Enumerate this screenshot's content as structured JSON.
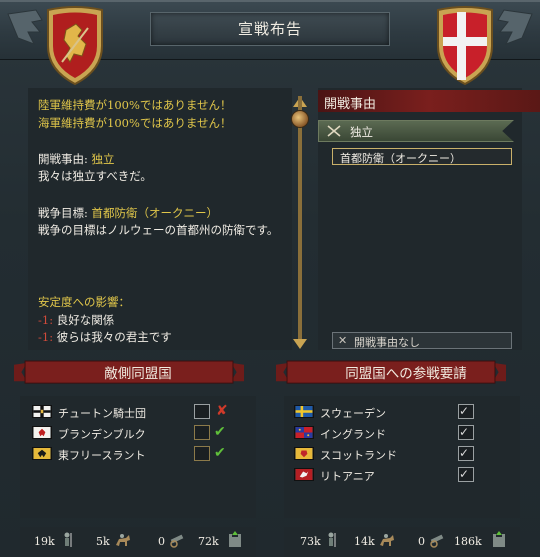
{
  "window": {
    "title": "宣戦布告"
  },
  "warnings": {
    "army": "陸軍維持費が100%ではありません！",
    "navy": "海軍維持費が100%ではありません！"
  },
  "casus_belli": {
    "label": "開戦事由: ",
    "value": "独立",
    "description": "我々は独立すべきだ。"
  },
  "war_goal": {
    "label": "戦争目標: ",
    "value": "首都防衛（オークニー）",
    "description": "戦争の目標はノルウェーの首都州の防衛です。"
  },
  "stability": {
    "title": "安定度への影響：",
    "items": [
      {
        "value": "-1",
        "text": "良好な関係"
      },
      {
        "value": "-1",
        "text": "彼らは我々の君主です"
      }
    ]
  },
  "right_panel": {
    "header": "開戦事由",
    "selected_cb": "独立",
    "selected_goal": "首都防衛（オークニー）",
    "no_cb": "開戦事由なし"
  },
  "enemy_allies": {
    "header": "敵側同盟国",
    "rows": [
      {
        "name": "チュートン騎士団",
        "flag": "teutonic-flag",
        "status": "declined"
      },
      {
        "name": "ブランデンブルク",
        "flag": "brandenburg-flag",
        "status": "accepted"
      },
      {
        "name": "東フリースラント",
        "flag": "east-frisia-flag",
        "status": "accepted"
      }
    ],
    "stats": {
      "infantry": "19k",
      "cavalry": "5k",
      "artillery": "0",
      "total": "72k"
    }
  },
  "call_allies": {
    "header": "同盟国への参戦要請",
    "rows": [
      {
        "name": "スウェーデン",
        "flag": "sweden-flag",
        "checked": true
      },
      {
        "name": "イングランド",
        "flag": "england-flag",
        "checked": true
      },
      {
        "name": "スコットランド",
        "flag": "scotland-flag",
        "checked": true
      },
      {
        "name": "リトアニア",
        "flag": "lithuania-flag",
        "checked": true
      }
    ],
    "stats": {
      "infantry": "73k",
      "cavalry": "14k",
      "artillery": "0",
      "total": "186k"
    }
  },
  "colors": {
    "accent_red": "#7a1f1d",
    "text_yellow": "#e0c64a",
    "check_green": "#5fbf3a",
    "cross_red": "#d03a2a"
  }
}
